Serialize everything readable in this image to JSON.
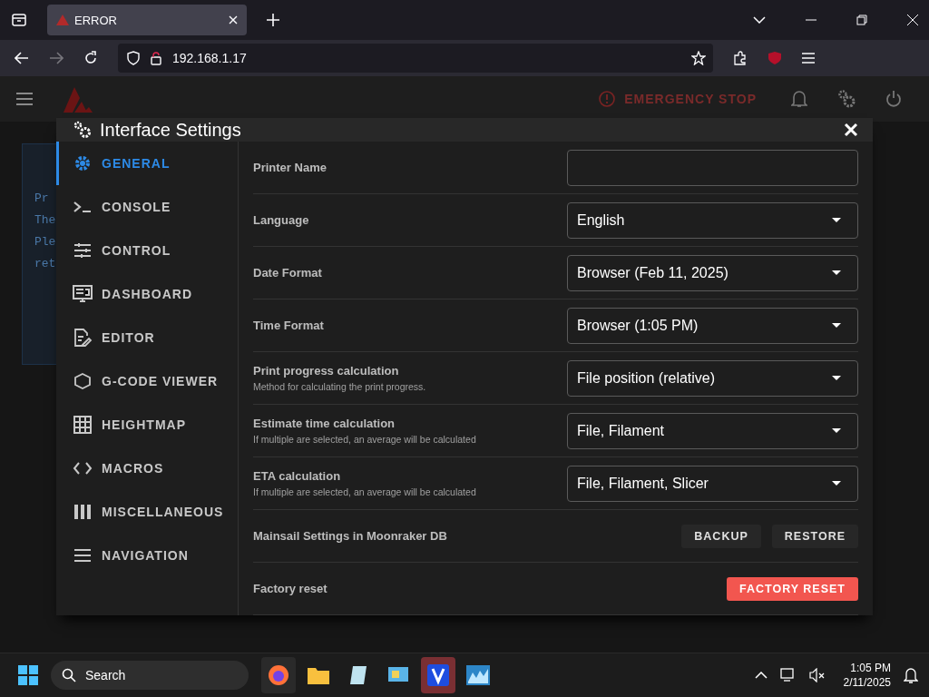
{
  "browser": {
    "tab": {
      "title": "ERROR"
    },
    "address": "192.168.1.17"
  },
  "app_bar": {
    "emergency_stop": "EMERGENCY STOP"
  },
  "background_card": {
    "lines": [
      "Pr",
      "The",
      "Ple",
      "ret"
    ]
  },
  "dialog": {
    "title": "Interface Settings",
    "sidebar": {
      "items": [
        {
          "label": "GENERAL",
          "selected": true
        },
        {
          "label": "CONSOLE",
          "selected": false
        },
        {
          "label": "CONTROL",
          "selected": false
        },
        {
          "label": "DASHBOARD",
          "selected": false
        },
        {
          "label": "EDITOR",
          "selected": false
        },
        {
          "label": "G-CODE VIEWER",
          "selected": false
        },
        {
          "label": "HEIGHTMAP",
          "selected": false
        },
        {
          "label": "MACROS",
          "selected": false
        },
        {
          "label": "MISCELLANEOUS",
          "selected": false
        },
        {
          "label": "NAVIGATION",
          "selected": false
        }
      ]
    },
    "settings": [
      {
        "kind": "text",
        "label": "Printer Name"
      },
      {
        "kind": "select",
        "label": "Language",
        "value": "English"
      },
      {
        "kind": "select",
        "label": "Date Format",
        "value": "Browser (Feb 11, 2025)"
      },
      {
        "kind": "select",
        "label": "Time Format",
        "value": "Browser (1:05 PM)"
      },
      {
        "kind": "select",
        "label": "Print progress calculation",
        "hint": "Method for calculating the print progress.",
        "value": "File position (relative)"
      },
      {
        "kind": "select",
        "label": "Estimate time calculation",
        "hint": "If multiple are selected, an average will be calculated",
        "value": "File, Filament"
      },
      {
        "kind": "select",
        "label": "ETA calculation",
        "hint": "If multiple are selected, an average will be calculated",
        "value": "File, Filament, Slicer"
      },
      {
        "kind": "buttons",
        "label": "Mainsail Settings in Moonraker DB",
        "buttons": [
          "BACKUP",
          "RESTORE"
        ]
      },
      {
        "kind": "danger",
        "label": "Factory reset",
        "buttons": [
          "FACTORY RESET"
        ]
      }
    ]
  },
  "taskbar": {
    "search": "Search",
    "time": "1:05 PM",
    "date": "2/11/2025"
  }
}
